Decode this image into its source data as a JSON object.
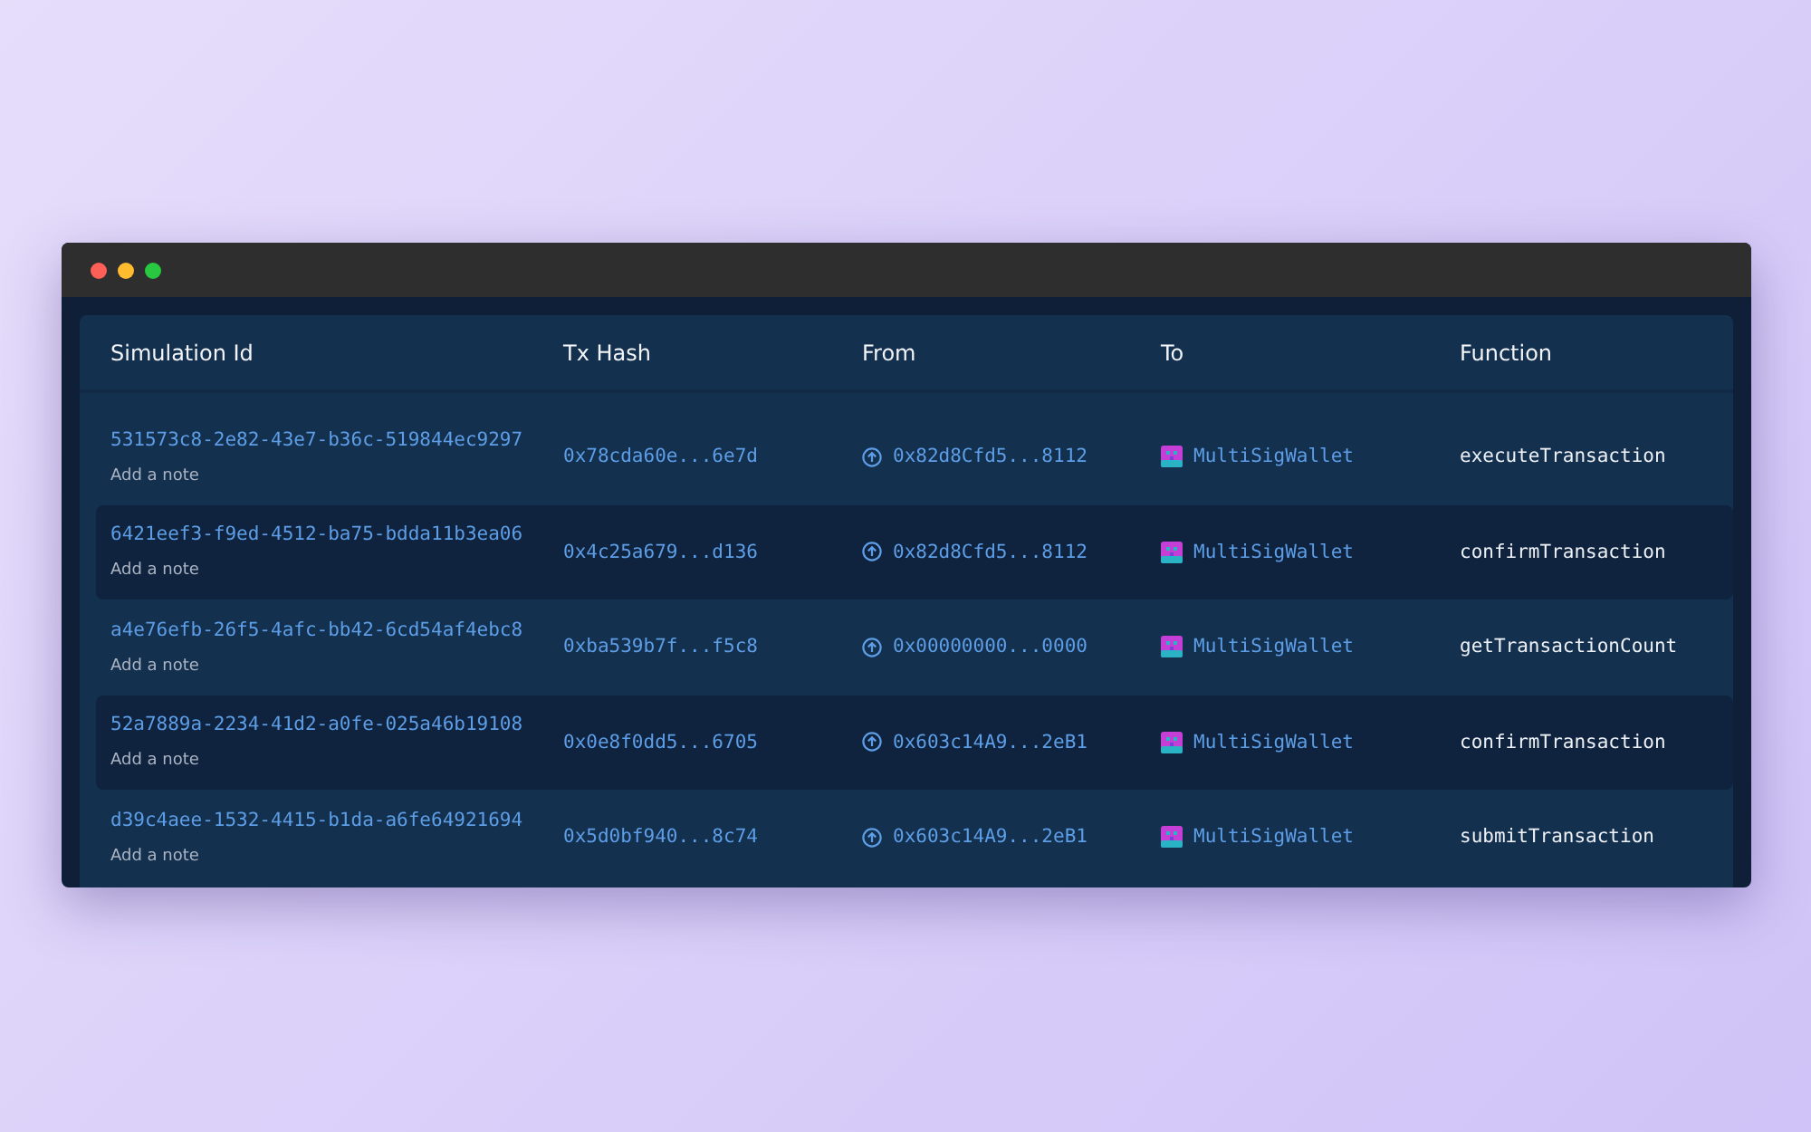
{
  "columns": [
    "Simulation Id",
    "Tx Hash",
    "From",
    "To",
    "Function"
  ],
  "rows": [
    {
      "simulation_id": "531573c8-2e82-43e7-b36c-519844ec9297",
      "note": "Add a note",
      "tx_hash": "0x78cda60e...6e7d",
      "from": "0x82d8Cfd5...8112",
      "to": "MultiSigWallet",
      "function": "executeTransaction"
    },
    {
      "simulation_id": "6421eef3-f9ed-4512-ba75-bdda11b3ea06",
      "note": "Add a note",
      "tx_hash": "0x4c25a679...d136",
      "from": "0x82d8Cfd5...8112",
      "to": "MultiSigWallet",
      "function": "confirmTransaction"
    },
    {
      "simulation_id": "a4e76efb-26f5-4afc-bb42-6cd54af4ebc8",
      "note": "Add a note",
      "tx_hash": "0xba539b7f...f5c8",
      "from": "0x00000000...0000",
      "to": "MultiSigWallet",
      "function": "getTransactionCount"
    },
    {
      "simulation_id": "52a7889a-2234-41d2-a0fe-025a46b19108",
      "note": "Add a note",
      "tx_hash": "0x0e8f0dd5...6705",
      "from": "0x603c14A9...2eB1",
      "to": "MultiSigWallet",
      "function": "confirmTransaction"
    },
    {
      "simulation_id": "d39c4aee-1532-4415-b1da-a6fe64921694",
      "note": "Add a note",
      "tx_hash": "0x5d0bf940...8c74",
      "from": "0x603c14A9...2eB1",
      "to": "MultiSigWallet",
      "function": "submitTransaction"
    }
  ]
}
